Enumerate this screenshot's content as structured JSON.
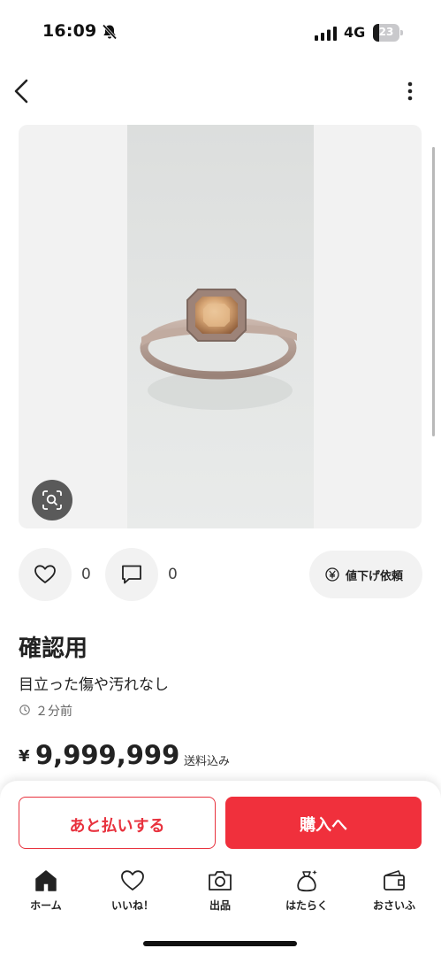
{
  "status_bar": {
    "time": "16:09",
    "network": "4G",
    "battery_level": 23,
    "battery_text": "23"
  },
  "nav": {
    "back_icon": "chevron-left-icon",
    "more_icon": "vertical-ellipsis-icon"
  },
  "gallery": {
    "lens_icon": "image-search-icon"
  },
  "actions": {
    "like_count": "0",
    "comment_count": "0",
    "price_request_label": "値下げ依頼"
  },
  "item": {
    "title": "確認用",
    "description": "目立った傷や汚れなし",
    "posted": "２分前",
    "currency": "¥",
    "price": "9,999,999",
    "shipping": "送料込み"
  },
  "buy_bar": {
    "pay_later_label": "あと払いする",
    "purchase_label": "購入へ"
  },
  "tabs": [
    {
      "label": "ホーム",
      "icon": "home-icon"
    },
    {
      "label": "いいね！",
      "icon": "heart-icon"
    },
    {
      "label": "出品",
      "icon": "camera-icon"
    },
    {
      "label": "はたらく",
      "icon": "money-bag-icon"
    },
    {
      "label": "おさいふ",
      "icon": "wallet-icon"
    }
  ],
  "colors": {
    "accent": "#f0303c",
    "background": "#ffffff"
  }
}
